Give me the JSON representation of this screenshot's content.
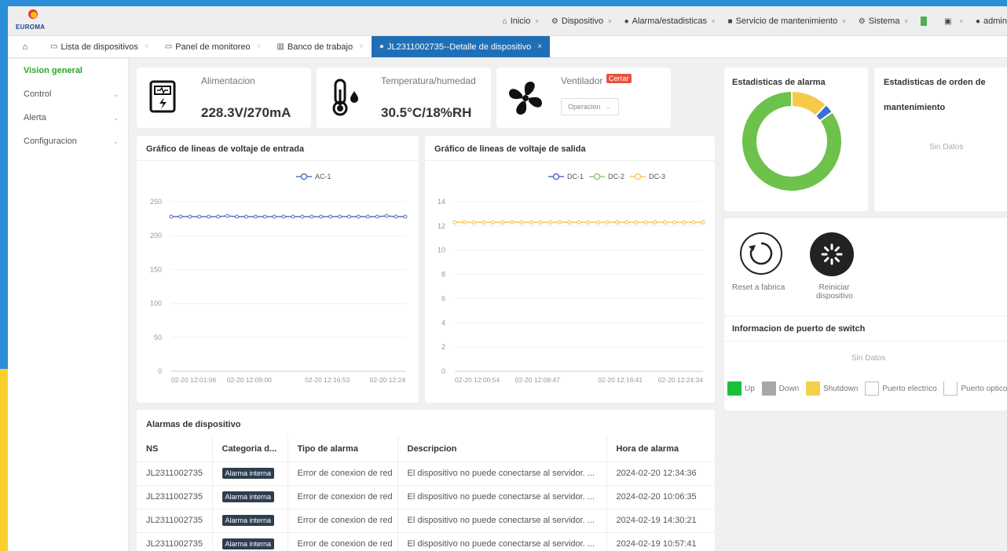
{
  "brand": {
    "logo_text": "EUROMA"
  },
  "nav": [
    {
      "icon": "home-icon",
      "glyph": "⌂",
      "label": "Inicio"
    },
    {
      "icon": "device-icon",
      "glyph": "⚙",
      "label": "Dispositivo"
    },
    {
      "icon": "alarm-icon",
      "glyph": "●",
      "label": "Alarma/estadisticas"
    },
    {
      "icon": "maintenance-icon",
      "glyph": "■",
      "label": "Servicio de mantenimiento"
    },
    {
      "icon": "system-icon",
      "glyph": "⚙",
      "label": "Sistema"
    }
  ],
  "user": {
    "label": "admin"
  },
  "tabs": {
    "list": "Lista de dispositivos",
    "monitor": "Panel de monitoreo",
    "bench": "Banco de trabajo",
    "detail": "JL2311002735--Detalle de dispositivo"
  },
  "sidebar": [
    {
      "label": "Vision general",
      "active": true
    },
    {
      "label": "Control"
    },
    {
      "label": "Alerta"
    },
    {
      "label": "Configuracion"
    }
  ],
  "status": {
    "power": {
      "label": "Alimentacion",
      "value": "228.3V/270mA"
    },
    "temp": {
      "label": "Temperatura/humedad",
      "value": "30.5°C/18%RH"
    },
    "fan": {
      "label": "Ventilador",
      "close_btn": "Cerrar",
      "select": "Operacion"
    }
  },
  "alarm_stats": {
    "title": "Estadisticas de alarma"
  },
  "order_stats": {
    "title": "Estadisticas de orden de",
    "title2": "mantenimiento",
    "empty": "Sin Datos"
  },
  "actions": {
    "reset": "Reset a fabrica",
    "reboot1": "Reiniciar",
    "reboot2": "dispositivo"
  },
  "switch_ports": {
    "title": "Informacion de puerto de switch",
    "empty": "Sin Datos",
    "legend": [
      {
        "label": "Up",
        "color": "#1bbf3a"
      },
      {
        "label": "Down",
        "color": "#a8a8a8"
      },
      {
        "label": "Shutdown",
        "color": "#f5d04b"
      },
      {
        "label": "Puerto electrico",
        "color": "#ffffff"
      },
      {
        "label": "Puerto optico",
        "color": "#ffffff"
      }
    ]
  },
  "alarms": {
    "title": "Alarmas de dispositivo",
    "headers": [
      "NS",
      "Categoria d...",
      "Tipo de alarma",
      "Descripcion",
      "Hora de alarma"
    ],
    "rows": [
      [
        "JL2311002735",
        "Alarma interna",
        "Error de conexion de red",
        "El dispositivo no puede conectarse al servidor. ...",
        "2024-02-20 12:34:36"
      ],
      [
        "JL2311002735",
        "Alarma interna",
        "Error de conexion de red",
        "El dispositivo no puede conectarse al servidor. ...",
        "2024-02-20 10:06:35"
      ],
      [
        "JL2311002735",
        "Alarma interna",
        "Error de conexion de red",
        "El dispositivo no puede conectarse al servidor. ...",
        "2024-02-19 14:30:21"
      ],
      [
        "JL2311002735",
        "Alarma interna",
        "Error de conexion de red",
        "El dispositivo no puede conectarse al servidor. ...",
        "2024-02-19 10:57:41"
      ]
    ]
  },
  "chart_data": [
    {
      "type": "line",
      "title": "Gráfico de lineas de voltaje de entrada",
      "x_ticks": [
        "02-20 12:01:06",
        "02-20 12:09:00",
        "02-20 12:16:53",
        "02-20 12:24"
      ],
      "ylim": [
        0,
        250
      ],
      "y_ticks": [
        0,
        50,
        100,
        150,
        200,
        250
      ],
      "series": [
        {
          "name": "AC-1",
          "color": "#5470c6",
          "values": [
            228,
            228,
            228,
            228,
            228,
            228,
            229,
            228,
            228,
            228,
            228,
            228,
            228,
            228,
            228,
            228,
            228,
            228,
            228,
            228,
            228,
            228,
            228,
            229,
            228,
            228
          ]
        }
      ]
    },
    {
      "type": "line",
      "title": "Gráfico de lineas de voltaje de salida",
      "x_ticks": [
        "02-20 12:00:54",
        "02-20 12:08:47",
        "02-20 12:16:41",
        "02-20 12:24:34"
      ],
      "ylim": [
        0,
        14
      ],
      "y_ticks": [
        0,
        2,
        4,
        6,
        8,
        10,
        12,
        14
      ],
      "series": [
        {
          "name": "DC-1",
          "color": "#5470c6",
          "values": [
            12.3,
            12.3,
            12.3,
            12.3,
            12.3,
            12.3,
            12.3,
            12.3,
            12.3,
            12.3,
            12.3,
            12.3,
            12.3,
            12.3,
            12.3,
            12.3,
            12.3,
            12.3,
            12.3,
            12.3,
            12.3,
            12.3,
            12.3,
            12.3,
            12.3,
            12.3,
            12.3
          ]
        },
        {
          "name": "DC-2",
          "color": "#91cc75",
          "values": [
            12.3,
            12.3,
            12.3,
            12.3,
            12.3,
            12.3,
            12.3,
            12.3,
            12.3,
            12.3,
            12.3,
            12.3,
            12.3,
            12.3,
            12.3,
            12.3,
            12.3,
            12.3,
            12.3,
            12.3,
            12.3,
            12.3,
            12.3,
            12.3,
            12.3,
            12.3,
            12.3
          ]
        },
        {
          "name": "DC-3",
          "color": "#fac858",
          "values": [
            12.3,
            12.3,
            12.3,
            12.3,
            12.3,
            12.3,
            12.3,
            12.3,
            12.3,
            12.3,
            12.3,
            12.3,
            12.3,
            12.3,
            12.3,
            12.3,
            12.3,
            12.3,
            12.3,
            12.3,
            12.3,
            12.3,
            12.3,
            12.3,
            12.3,
            12.3,
            12.3
          ]
        }
      ]
    },
    {
      "type": "pie",
      "title": "Estadisticas de alarma",
      "slices": [
        {
          "value": 85,
          "color": "#6cc24a"
        },
        {
          "value": 12,
          "color": "#f7c948"
        },
        {
          "value": 3,
          "color": "#3b6fd1"
        }
      ]
    }
  ]
}
